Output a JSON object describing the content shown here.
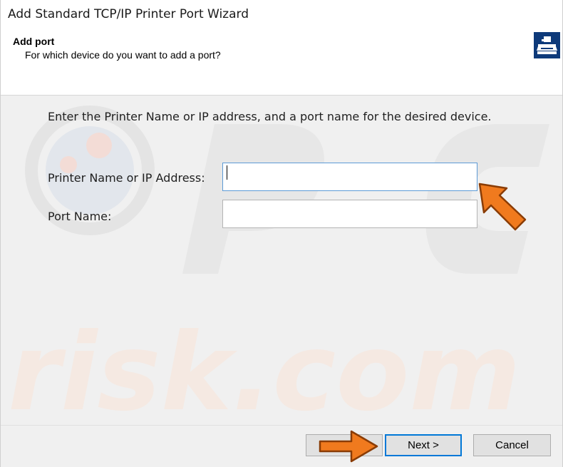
{
  "window": {
    "title": "Add Standard TCP/IP Printer Port Wizard"
  },
  "header": {
    "title": "Add port",
    "subtitle": "For which device do you want to add a port?",
    "icon": "printer-port-icon"
  },
  "content": {
    "instruction": "Enter the Printer Name or IP address, and a port name for the desired device.",
    "printer_name_label": "Printer Name or IP Address:",
    "printer_name_value": "",
    "port_name_label": "Port Name:",
    "port_name_value": ""
  },
  "footer": {
    "back_label": "",
    "next_label": "Next >",
    "cancel_label": "Cancel"
  },
  "annotations": {
    "arrow_color": "#f07a1e"
  }
}
